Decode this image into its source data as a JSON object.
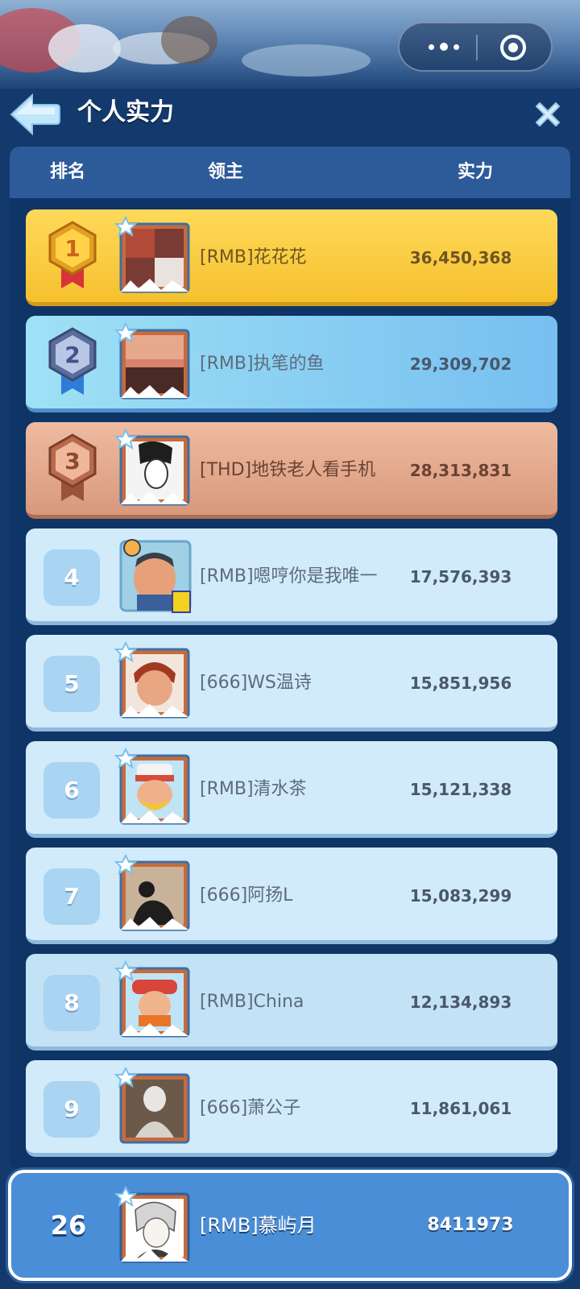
{
  "header": {
    "title": "个人实力"
  },
  "columns": {
    "rank": "排名",
    "lord": "领主",
    "power": "实力"
  },
  "rows": [
    {
      "rank": "1",
      "name": "[RMB]花花花",
      "power": "36,450,368",
      "tier": "gold"
    },
    {
      "rank": "2",
      "name": "[RMB]执笔的鱼",
      "power": "29,309,702",
      "tier": "silver"
    },
    {
      "rank": "3",
      "name": "[THD]地铁老人看手机",
      "power": "28,313,831",
      "tier": "bronze"
    },
    {
      "rank": "4",
      "name": "[RMB]嗯哼你是我唯一",
      "power": "17,576,393",
      "tier": "plain"
    },
    {
      "rank": "5",
      "name": "[666]WS温诗",
      "power": "15,851,956",
      "tier": "plain"
    },
    {
      "rank": "6",
      "name": "[RMB]清水茶",
      "power": "15,121,338",
      "tier": "plain"
    },
    {
      "rank": "7",
      "name": "[666]阿扬L",
      "power": "15,083,299",
      "tier": "plain"
    },
    {
      "rank": "8",
      "name": "[RMB]China",
      "power": "12,134,893",
      "tier": "plain"
    },
    {
      "rank": "9",
      "name": "[666]萧公子",
      "power": "11,861,061",
      "tier": "plain"
    }
  ],
  "my_rank": {
    "rank": "26",
    "name": "[RMB]慕屿月",
    "power": "8411973"
  },
  "icons": {
    "back": "back-arrow-icon",
    "close": "close-x-icon",
    "menu": "more-dots-icon",
    "target": "target-icon",
    "medal_gold": "medal-1-icon",
    "medal_silver": "medal-2-icon",
    "medal_bronze": "medal-3-icon"
  },
  "colors": {
    "background": "#14396c",
    "header_bar": "#2d5b99",
    "gold": "#f5c12e",
    "silver": "#76bff0",
    "bronze": "#d8997c",
    "plain_row": "#d1ebfb",
    "my_row": "#4a8ed8"
  }
}
